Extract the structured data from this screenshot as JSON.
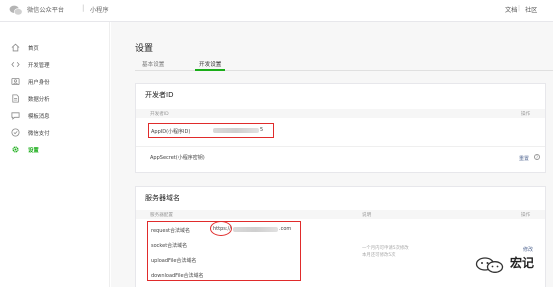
{
  "header": {
    "brand": "微信公众平台",
    "separator": "|",
    "app_name": "小程序",
    "links": [
      "文档",
      "社区"
    ],
    "link_separator": "|"
  },
  "sidebar": {
    "items": [
      {
        "label": "首页",
        "icon": "home-icon"
      },
      {
        "label": "开发管理",
        "icon": "code-icon"
      },
      {
        "label": "用户身份",
        "icon": "user-icon"
      },
      {
        "label": "数据分析",
        "icon": "chart-icon"
      },
      {
        "label": "模板消息",
        "icon": "message-icon"
      },
      {
        "label": "微信支付",
        "icon": "pay-icon"
      },
      {
        "label": "设置",
        "icon": "gear-icon",
        "active": true
      }
    ]
  },
  "main": {
    "title": "设置",
    "tabs": [
      {
        "label": "基本设置"
      },
      {
        "label": "开发设置",
        "active": true
      }
    ],
    "developer_id": {
      "title": "开发者ID",
      "col_name": "开发者ID",
      "col_action": "操作",
      "rows": [
        {
          "label": "AppID(小程序ID)",
          "value_suffix": "5"
        },
        {
          "label": "AppSecret(小程序密钥)",
          "action": "重置",
          "help": "?"
        }
      ]
    },
    "server_domain": {
      "title": "服务器域名",
      "col_name": "服务器配置",
      "col_desc": "说明",
      "col_action": "操作",
      "rows": [
        {
          "label": "request合法域名",
          "value_prefix": "https://",
          "value_suffix": ".com"
        },
        {
          "label": "socket合法域名"
        },
        {
          "label": "uploadFile合法域名"
        },
        {
          "label": "downloadFile合法域名"
        }
      ],
      "desc_line1": "一个月内可申请5次修改",
      "desc_line2": "本月还可修改5次",
      "action": "修改"
    }
  },
  "watermark": {
    "text": "宏记",
    "icon": "wechat-icon"
  },
  "colors": {
    "accent": "#1aad19",
    "link": "#576b95",
    "annotation": "#e02b2b"
  }
}
